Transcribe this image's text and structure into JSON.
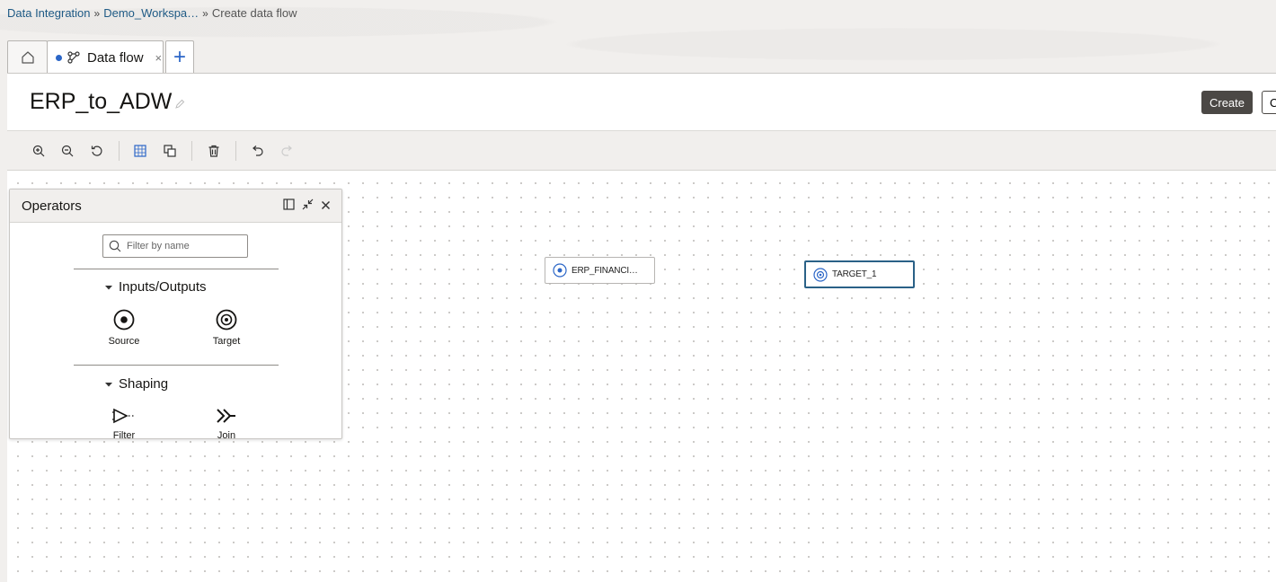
{
  "breadcrumb": {
    "items": [
      "Data Integration",
      "Demo_Workspa…"
    ],
    "separator": "»",
    "current": "Create data flow"
  },
  "tabs": {
    "active_label": "Data flow",
    "close_glyph": "×",
    "add_glyph": "+"
  },
  "header": {
    "title": "ERP_to_ADW",
    "create_label": "Create",
    "second_button_label": "C"
  },
  "toolbar": {
    "buttons": [
      "zoom-in-icon",
      "zoom-out-icon",
      "reset-icon",
      "grid-icon",
      "copy-icon",
      "delete-icon",
      "undo-icon",
      "redo-icon"
    ]
  },
  "canvas": {
    "nodes": [
      {
        "label": "ERP_FINANCI…",
        "icon": "source-icon",
        "selected": false
      },
      {
        "label": "TARGET_1",
        "icon": "target-icon",
        "selected": true
      }
    ]
  },
  "operators": {
    "title": "Operators",
    "search_placeholder": "Filter by name",
    "sections": [
      {
        "label": "Inputs/Outputs",
        "items": [
          "Source",
          "Target"
        ]
      },
      {
        "label": "Shaping",
        "items": [
          "Filter",
          "Join"
        ]
      }
    ]
  },
  "colors": {
    "accent": "#2b66c7",
    "link": "#1e5a85",
    "primary_button": "#4b4845",
    "selected_node_border": "#2a6187"
  }
}
